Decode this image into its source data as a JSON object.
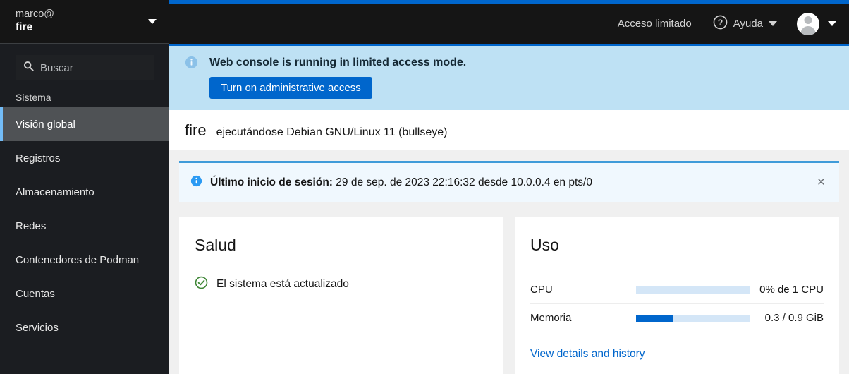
{
  "sidebar": {
    "user": "marco@",
    "host": "fire",
    "host_dropdown_icon": "chevron-down-icon",
    "search": {
      "icon": "search-icon",
      "placeholder": "Buscar",
      "value": ""
    },
    "group_title": "Sistema",
    "items": [
      {
        "label": "Visión global",
        "active": true
      },
      {
        "label": "Registros",
        "active": false
      },
      {
        "label": "Almacenamiento",
        "active": false
      },
      {
        "label": "Redes",
        "active": false
      },
      {
        "label": "Contenedores de Podman",
        "active": false
      },
      {
        "label": "Cuentas",
        "active": false
      },
      {
        "label": "Servicios",
        "active": false
      }
    ]
  },
  "topbar": {
    "limited_access_label": "Acceso limitado",
    "help_label": "Ayuda",
    "help_icon": "question-circle-icon",
    "help_caret_icon": "chevron-down-icon",
    "avatar_icon": "user-avatar-icon",
    "avatar_caret_icon": "chevron-down-icon",
    "accent_color": "#0066cc"
  },
  "limited_alert": {
    "icon": "info-circle-icon",
    "title": "Web console is running in limited access mode.",
    "button_label": "Turn on administrative access",
    "background_color": "#bee1f4",
    "button_color": "#0066cc"
  },
  "page_title": {
    "host": "fire",
    "subtitle": "ejecutándose Debian GNU/Linux 11 (bullseye)"
  },
  "login_alert": {
    "icon": "info-circle-icon",
    "label": "Último inicio de sesión:",
    "detail": " 29 de sep. de 2023 22:16:32 desde 10.0.0.4 en pts/0",
    "close_icon": "close-icon",
    "close_label": "×",
    "background_color": "#f0f8fe",
    "border_color": "#3f9bd9"
  },
  "health_card": {
    "title": "Salud",
    "status_icon": "check-circle-icon",
    "status_color": "#3e8635",
    "status_text": "El sistema está actualizado"
  },
  "usage_card": {
    "title": "Uso",
    "rows": [
      {
        "label": "CPU",
        "percent": 0,
        "value": "0% de 1 CPU"
      },
      {
        "label": "Memoria",
        "percent": 33,
        "value": "0.3 / 0.9 GiB"
      }
    ],
    "link_label": "View details and history",
    "bar_track_color": "#d4e6f7",
    "bar_fill_color": "#0066cc"
  }
}
